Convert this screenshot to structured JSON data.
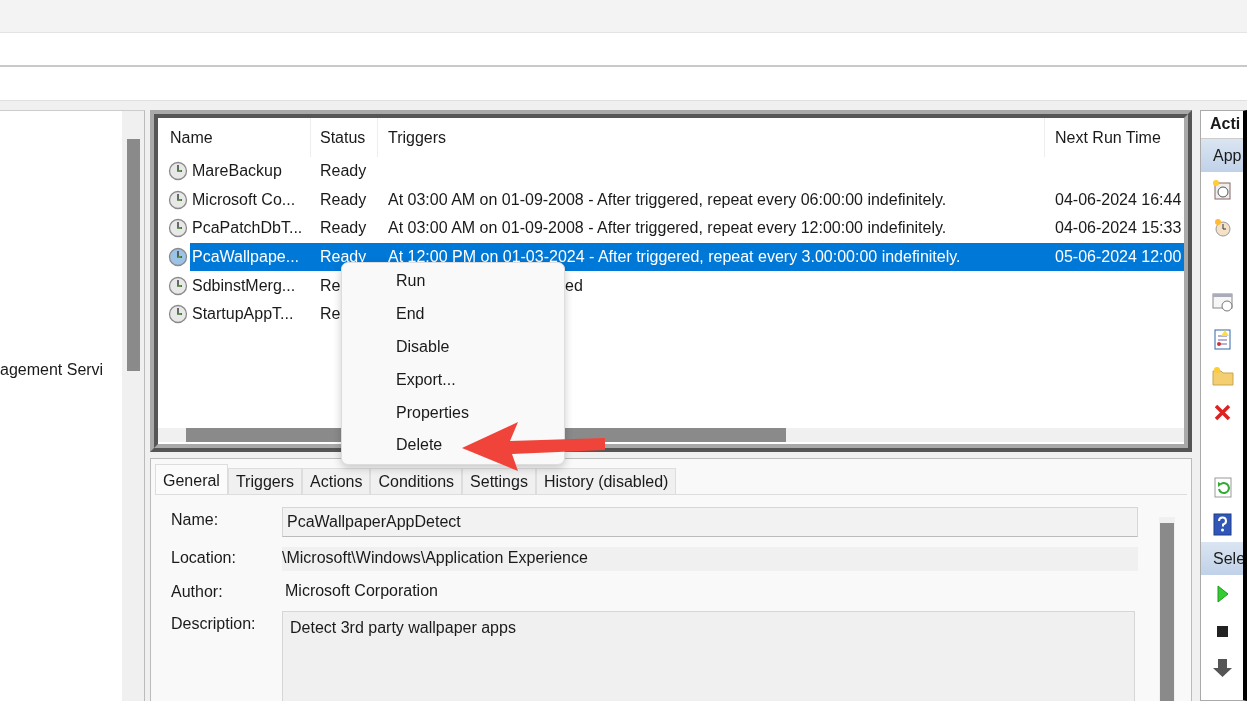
{
  "left_pane": {
    "item": "agement Servi"
  },
  "task_list": {
    "columns": [
      "Name",
      "Status",
      "Triggers",
      "Next Run Time"
    ],
    "rows": [
      {
        "name": "MareBackup",
        "status": "Ready",
        "selected": false
      },
      {
        "name": "Microsoft Co...",
        "status": "Ready",
        "triggers": "At 03:00 AM on 01-09-2008 - After triggered, repeat every 06:00:00 indefinitely.",
        "next_run_time": "04-06-2024 16:44",
        "selected": false
      },
      {
        "name": "PcaPatchDbT...",
        "status": "Ready",
        "triggers": "At 03:00 AM on 01-09-2008 - After triggered, repeat every 12:00:00 indefinitely.",
        "next_run_time": "04-06-2024 15:33",
        "selected": false
      },
      {
        "name": "PcaWallpape...",
        "status": "Ready",
        "triggers": "At 12:00 PM on 01-03-2024 - After triggered, repeat every 3.00:00:00 indefinitely.",
        "next_run_time": "05-06-2024 12:00",
        "selected": true
      },
      {
        "name": "SdbinstMerg...",
        "status": "Re",
        "triggers": "ed",
        "selected": false,
        "covered": true
      },
      {
        "name": "StartupAppT...",
        "status": "Re",
        "selected": false,
        "covered": true
      }
    ]
  },
  "context_menu": {
    "items": [
      "Run",
      "End",
      "Disable",
      "Export...",
      "Properties",
      "Delete"
    ]
  },
  "details": {
    "tabs": [
      {
        "label": "General",
        "selected": true
      },
      {
        "label": "Triggers",
        "selected": false
      },
      {
        "label": "Actions",
        "selected": false
      },
      {
        "label": "Conditions",
        "selected": false
      },
      {
        "label": "Settings",
        "selected": false
      },
      {
        "label": "History (disabled)",
        "selected": false
      }
    ],
    "fields": [
      {
        "label": "Name:",
        "value": "PcaWallpaperAppDetect",
        "kind": "input"
      },
      {
        "label": "Location:",
        "value": "\\Microsoft\\Windows\\Application Experience",
        "kind": "readonly"
      },
      {
        "label": "Author:",
        "value": "Microsoft Corporation",
        "kind": "text"
      },
      {
        "label": "Description:",
        "value": "Detect 3rd party wallpaper apps",
        "kind": "textarea"
      }
    ]
  },
  "actions_pane": {
    "title": "Acti",
    "sections": [
      {
        "title": "App"
      },
      {
        "title": "Sele"
      }
    ]
  }
}
